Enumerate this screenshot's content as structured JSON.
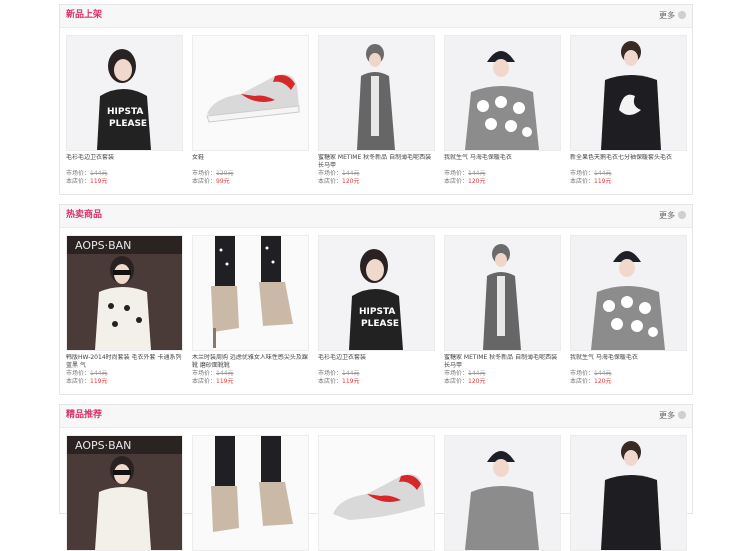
{
  "sections": [
    {
      "title": "新品上架",
      "more": "更多",
      "items": [
        {
          "name": "毛衫毛边卫衣套装",
          "market_label": "市场价：",
          "market_price": "144元",
          "store_label": "本店价：",
          "store_price": "119元",
          "image": "model-black-sweater-image"
        },
        {
          "name": "女鞋",
          "market_label": "市场价：",
          "market_price": "120元",
          "store_label": "本店价：",
          "store_price": "99元",
          "image": "sneaker-image"
        },
        {
          "name": "蜜糖家 METIME 秋冬新品 自制薄毛呢西装长马甲",
          "market_label": "市场价：",
          "market_price": "144元",
          "store_label": "本店价：",
          "store_price": "120元",
          "image": "model-grey-coat-image"
        },
        {
          "name": "我就生气 马海毛保暖毛衣",
          "market_label": "市场价：",
          "market_price": "144元",
          "store_label": "本店价：",
          "store_price": "120元",
          "image": "model-beanie-sweater-image"
        },
        {
          "name": "新全果色天鹅毛衣七分袖保暖套头毛衣",
          "market_label": "市场价：",
          "market_price": "144元",
          "store_label": "本店价：",
          "store_price": "119元",
          "image": "model-swan-sweater-image"
        }
      ]
    },
    {
      "title": "热卖商品",
      "more": "更多",
      "items": [
        {
          "name": "韩版HW-2014时尚套装 毛衣外套 卡通系列 蓝黑 气",
          "market_label": "市场价：",
          "market_price": "144元",
          "store_label": "本店价：",
          "store_price": "119元",
          "image": "model-sunglasses-image"
        },
        {
          "name": "木兰时装周购 远虑优雅女人味性感尖头及踝靴 磨砂面靴靴",
          "market_label": "市场价：",
          "market_price": "144元",
          "store_label": "本店价：",
          "store_price": "119元",
          "image": "ankle-boots-image"
        },
        {
          "name": "毛衫毛边卫衣套装",
          "market_label": "市场价：",
          "market_price": "144元",
          "store_label": "本店价：",
          "store_price": "119元",
          "image": "model-black-sweater-image"
        },
        {
          "name": "蜜糖家 METIME 秋冬新品 自制薄毛呢西装长马甲",
          "market_label": "市场价：",
          "market_price": "144元",
          "store_label": "本店价：",
          "store_price": "120元",
          "image": "model-grey-coat-image"
        },
        {
          "name": "我就生气 马海毛保暖毛衣",
          "market_label": "市场价：",
          "market_price": "144元",
          "store_label": "本店价：",
          "store_price": "120元",
          "image": "model-beanie-sweater-image"
        }
      ]
    },
    {
      "title": "精品推荐",
      "more": "更多",
      "items": [
        {
          "name": "",
          "market_label": "",
          "market_price": "",
          "store_label": "",
          "store_price": "",
          "image": "model-sunglasses-image"
        },
        {
          "name": "",
          "market_label": "",
          "market_price": "",
          "store_label": "",
          "store_price": "",
          "image": "ankle-boots-image"
        },
        {
          "name": "",
          "market_label": "",
          "market_price": "",
          "store_label": "",
          "store_price": "",
          "image": "sneaker-image"
        },
        {
          "name": "",
          "market_label": "",
          "market_price": "",
          "store_label": "",
          "store_price": "",
          "image": "model-beanie-sweater-image"
        },
        {
          "name": "",
          "market_label": "",
          "market_price": "",
          "store_label": "",
          "store_price": "",
          "image": "model-swan-sweater-image"
        }
      ]
    }
  ],
  "colors": {
    "accent": "#d6336c",
    "price": "#e4393c",
    "border": "#e6e6e6",
    "header_bg": "#f7f7f7"
  }
}
